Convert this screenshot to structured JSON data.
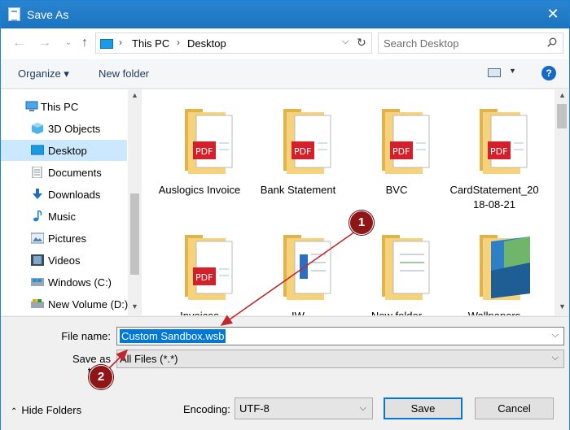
{
  "window": {
    "title": "Save As"
  },
  "address": {
    "crumbs": [
      "This PC",
      "Desktop"
    ]
  },
  "search": {
    "placeholder": "Search Desktop"
  },
  "toolbar": {
    "organize": "Organize ▾",
    "new_folder": "New folder",
    "help": "?"
  },
  "nav": {
    "items": [
      {
        "label": "This PC",
        "icon": "computer-icon"
      },
      {
        "label": "3D Objects",
        "icon": "cube-icon"
      },
      {
        "label": "Desktop",
        "icon": "desktop-icon"
      },
      {
        "label": "Documents",
        "icon": "documents-icon"
      },
      {
        "label": "Downloads",
        "icon": "download-arrow-icon"
      },
      {
        "label": "Music",
        "icon": "music-note-icon"
      },
      {
        "label": "Pictures",
        "icon": "pictures-icon"
      },
      {
        "label": "Videos",
        "icon": "videos-icon"
      },
      {
        "label": "Windows (C:)",
        "icon": "windows-drive-icon"
      },
      {
        "label": "New Volume (D:)",
        "icon": "drive-icon"
      }
    ]
  },
  "files": [
    {
      "name": "Auslogics Invoice",
      "kind": "pdf"
    },
    {
      "name": "Bank Statement",
      "kind": "pdf"
    },
    {
      "name": "BVC",
      "kind": "pdf"
    },
    {
      "name": "CardStatement_2018-08-21",
      "kind": "pdf"
    },
    {
      "name": "Invoices",
      "kind": "pdf"
    },
    {
      "name": "IW",
      "kind": "doc"
    },
    {
      "name": "New folder",
      "kind": "doc"
    },
    {
      "name": "Wallpapers",
      "kind": "image"
    }
  ],
  "form": {
    "file_name_label": "File name:",
    "file_name_value": "Custom Sandbox.wsb",
    "save_type_label": "Save as type:",
    "save_type_value": "All Files  (*.*)",
    "hide_folders": "Hide Folders",
    "encoding_label": "Encoding:",
    "encoding_value": "UTF-8",
    "save": "Save",
    "cancel": "Cancel"
  },
  "annotations": {
    "badge1": "1",
    "badge2": "2"
  },
  "colors": {
    "accent": "#0078d7",
    "titlebar": "#1e79c5",
    "badge": "#8f1616",
    "arrow": "#c0282d"
  }
}
